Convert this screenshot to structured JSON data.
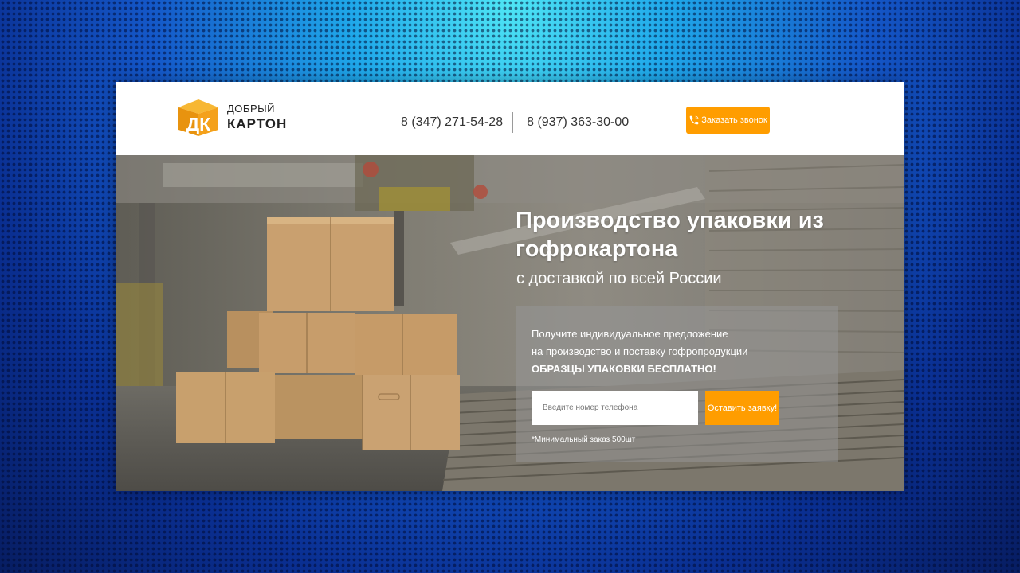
{
  "brand": {
    "mark": "ДК",
    "line1": "ДОБРЫЙ",
    "line2": "КАРТОН"
  },
  "header": {
    "phones": [
      "8 (347) 271-54-28",
      "8 (937) 363-30-00"
    ],
    "call_button": {
      "label": "Заказать звонок",
      "icon": "phone-icon"
    }
  },
  "hero": {
    "title": "Производство упаковки из гофрокартона",
    "subtitle": "с доставкой по всей России",
    "offer": {
      "line1": "Получите индивидуальное предложение",
      "line2": "на производство и поставку гофропродукции",
      "highlight": "ОБРАЗЦЫ УПАКОВКИ БЕСПЛАТНО!"
    },
    "form": {
      "phone_placeholder": "Введите номер телефона",
      "submit_label": "Оставить заявку!"
    },
    "note": "*Минимальный заказ 500шт"
  },
  "colors": {
    "accent": "#ff9d00",
    "logo_orange": "#f4a11b",
    "text_dark": "#333333",
    "cardboard": "#c9a06f"
  }
}
